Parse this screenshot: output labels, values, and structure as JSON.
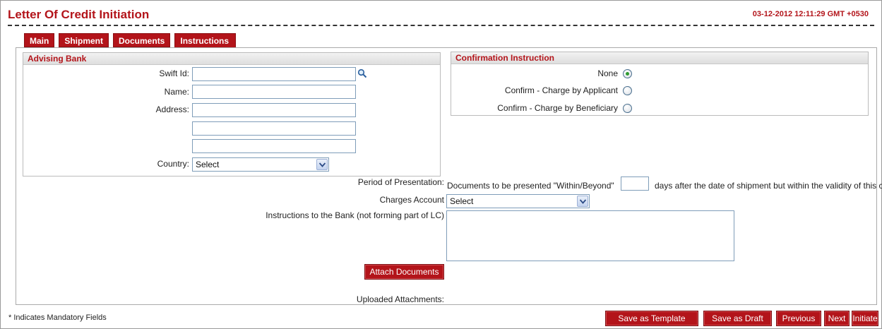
{
  "header": {
    "title": "Letter Of Credit Initiation",
    "datetime": "03-12-2012 12:11:29 GMT +0530"
  },
  "tabs": [
    {
      "label": "Main"
    },
    {
      "label": "Shipment"
    },
    {
      "label": "Documents"
    },
    {
      "label": "Instructions"
    }
  ],
  "advising_bank": {
    "header": "Advising Bank",
    "swift_label": "Swift Id:",
    "swift_value": "",
    "name_label": "Name:",
    "name_value": "",
    "address_label": "Address:",
    "address_lines": [
      "",
      "",
      ""
    ],
    "country_label": "Country:",
    "country_value": "Select"
  },
  "confirmation": {
    "header": "Confirmation Instruction",
    "options": [
      {
        "label": "None",
        "selected": true
      },
      {
        "label": "Confirm - Charge by Applicant",
        "selected": false
      },
      {
        "label": "Confirm - Charge by Beneficiary",
        "selected": false
      }
    ]
  },
  "presentation": {
    "label": "Period of Presentation:",
    "prefix": "Documents to be presented \"Within/Beyond\"",
    "days_value": "",
    "suffix": "days after the date of shipment but within the validity of this credit."
  },
  "charges": {
    "label": "Charges Account",
    "value": "Select"
  },
  "instructions": {
    "label": "Instructions to the Bank (not forming part of LC)",
    "value": ""
  },
  "attach_button": "Attach Documents",
  "uploaded_label": "Uploaded Attachments:",
  "footer": {
    "mandatory_note": "* Indicates Mandatory Fields",
    "buttons": {
      "save_template": "Save as Template",
      "save_draft": "Save as Draft",
      "previous": "Previous",
      "next": "Next",
      "initiate": "Initiate"
    }
  },
  "colors": {
    "brand": "#b3141a",
    "radio_selected": "#2f9a2f"
  },
  "icons": {
    "swift_lookup": "search-icon",
    "dropdown": "chevron-down-icon"
  }
}
